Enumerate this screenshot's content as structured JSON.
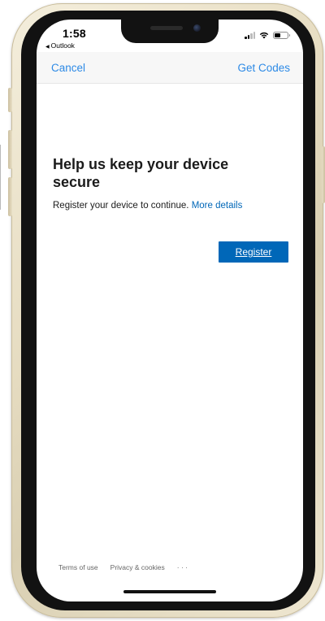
{
  "status": {
    "time": "1:58",
    "back_app": "Outlook",
    "back_arrow": "◀",
    "battery_level_percent": 45
  },
  "nav": {
    "cancel_label": "Cancel",
    "get_codes_label": "Get Codes"
  },
  "main": {
    "title": "Help us keep your device secure",
    "description": "Register your device to continue.",
    "more_details_link": "More details",
    "register_button": "Register"
  },
  "footer": {
    "terms": "Terms of use",
    "privacy": "Privacy & cookies",
    "more": "· · ·"
  },
  "colors": {
    "link_blue": "#2d8ae6",
    "button_blue": "#0067b8",
    "frame_gold": "#e6dcc1",
    "bezel": "#121212"
  },
  "icons": [
    "signal-icon",
    "wifi-icon",
    "battery-icon",
    "back-arrow-icon"
  ]
}
